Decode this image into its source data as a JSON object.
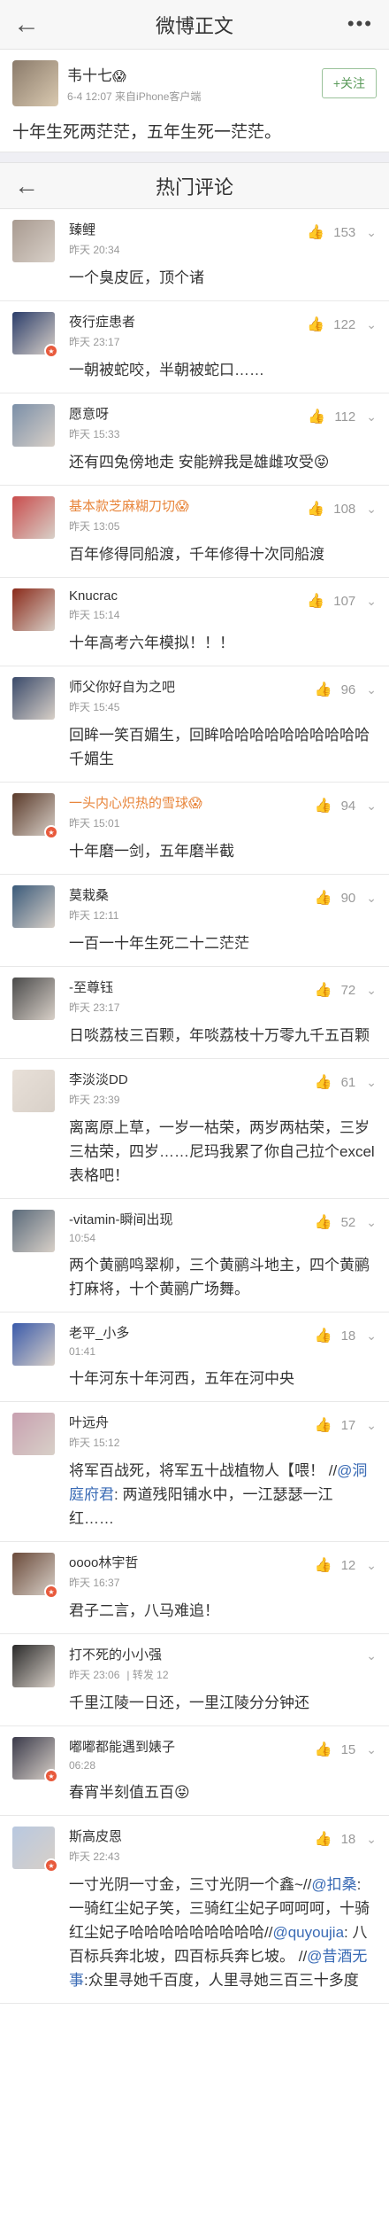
{
  "nav": {
    "title": "微博正文",
    "back_icon": "←",
    "more_icon": "•••"
  },
  "post": {
    "author": "韦十七",
    "emoji": "😱",
    "meta": "6-4 12:07  来自iPhone客户端",
    "follow_label": "+关注",
    "text": "十年生死两茫茫，五年生死一茫茫。"
  },
  "hot": {
    "title": "热门评论",
    "back_icon": "←"
  },
  "comments": [
    {
      "name": "臻鲤",
      "time": "昨天 20:34",
      "likes": "153",
      "text": "一个臭皮匠，顶个诸",
      "color": "#a89a90",
      "vip": false
    },
    {
      "name": "夜行症患者",
      "time": "昨天 23:17",
      "likes": "122",
      "text": "一朝被蛇咬，半朝被蛇口……",
      "color": "#2b3d6a",
      "vip": true
    },
    {
      "name": "愿意呀",
      "time": "昨天 15:33",
      "likes": "112",
      "text": "还有四兔傍地走 安能辨我是雄雌攻受😝",
      "color": "#7b8fa8",
      "vip": false
    },
    {
      "name": "基本款芝麻糊刀切",
      "time": "昨天 13:05",
      "likes": "108",
      "text": "百年修得同船渡，千年修得十次同船渡",
      "color": "#c94d4d",
      "vip": false,
      "orange": true,
      "emoji": "😱"
    },
    {
      "name": "Knucrac",
      "time": "昨天 15:14",
      "likes": "107",
      "text": "十年高考六年模拟！！！",
      "color": "#8a2a1a",
      "vip": false
    },
    {
      "name": "师父你好自为之吧",
      "time": "昨天 15:45",
      "likes": "96",
      "text": "回眸一笑百媚生，回眸哈哈哈哈哈哈哈哈哈哈千媚生",
      "color": "#3a4a6a",
      "vip": false
    },
    {
      "name": "一头内心炽热的雪球",
      "time": "昨天 15:01",
      "likes": "94",
      "text": "十年磨一剑，五年磨半截",
      "color": "#5a3a2a",
      "vip": true,
      "orange": true,
      "emoji": "😱"
    },
    {
      "name": "莫栽桑",
      "time": "昨天 12:11",
      "likes": "90",
      "text": "一百一十年生死二十二茫茫",
      "color": "#3a5a7a",
      "vip": false
    },
    {
      "name": "-至尊钰",
      "time": "昨天 23:17",
      "likes": "72",
      "text": "日啖荔枝三百颗，年啖荔枝十万零九千五百颗",
      "color": "#4a4a4a",
      "vip": false
    },
    {
      "name": "李淡淡DD",
      "time": "昨天 23:39",
      "likes": "61",
      "text": "离离原上草，一岁一枯荣，两岁两枯荣，三岁三枯荣，四岁……尼玛我累了你自己拉个excel表格吧！",
      "color": "#e8e0d8",
      "vip": false
    },
    {
      "name": "-vitamin-瞬间出现",
      "time": "10:54",
      "likes": "52",
      "text": "两个黄鹂鸣翠柳，三个黄鹂斗地主，四个黄鹂打麻将，十个黄鹂广场舞。",
      "color": "#5a6a7a",
      "vip": false
    },
    {
      "name": "老平_小多",
      "time": "01:41",
      "likes": "18",
      "text": "十年河东十年河西，五年在河中央",
      "color": "#3a5aaa",
      "vip": false
    },
    {
      "name": "叶远舟",
      "time": "昨天 15:12",
      "likes": "17",
      "text_parts": [
        "将军百战死，将军五十战植物人【喂！ //",
        "@洞庭府君",
        ": 两道残阳铺水中，一江瑟瑟一江红……"
      ],
      "color": "#c8a0b0",
      "vip": false
    },
    {
      "name": "oooo林宇哲",
      "time": "昨天 16:37",
      "likes": "12",
      "text": "君子二言，八马难追！",
      "color": "#6a4a3a",
      "vip": true
    },
    {
      "name": "打不死的小小强",
      "time": "昨天 23:06",
      "likes": "",
      "source": "| 转发 12",
      "text": "千里江陵一日还，一里江陵分分钟还",
      "color": "#2a2a2a",
      "vip": false
    },
    {
      "name": "嘟嘟都能遇到婊子",
      "time": "06:28",
      "likes": "15",
      "text": "春宵半刻值五百😝",
      "color": "#3a3a4a",
      "vip": true
    },
    {
      "name": "斯高皮恩",
      "time": "昨天 22:43",
      "likes": "18",
      "text_parts": [
        "一寸光阴一寸金，三寸光阴一个鑫~//",
        "@扣桑",
        ": 一骑红尘妃子笑，三骑红尘妃子呵呵呵，十骑红尘妃子哈哈哈哈哈哈哈哈哈//",
        "@quyoujia",
        ": 八百标兵奔北坡，四百标兵奔匕坡。 //",
        "@昔酒无事",
        ":众里寻她千百度，人里寻她三百三十多度"
      ],
      "color": "#b8c8e0",
      "vip": true
    }
  ],
  "icons": {
    "thumb": "👍",
    "chevron": "⌄"
  }
}
